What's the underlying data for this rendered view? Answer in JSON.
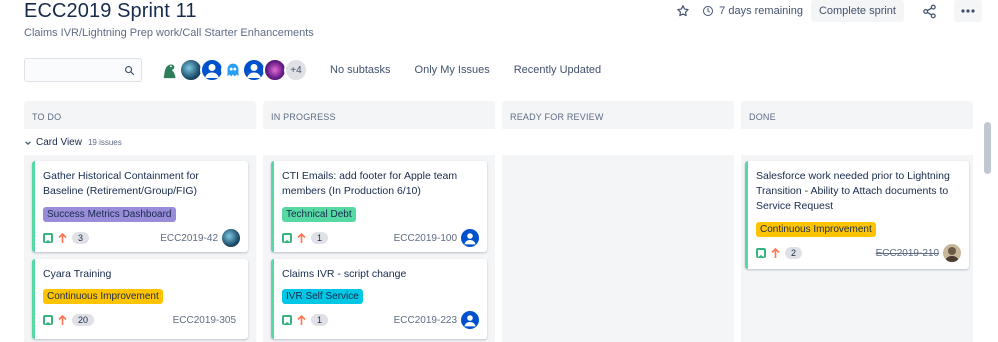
{
  "header": {
    "title": "ECC2019 Sprint 11",
    "subtitle": "Claims IVR/Lightning Prep work/Call Starter Enhancements",
    "remaining": "7 days remaining",
    "complete_label": "Complete sprint",
    "star_icon": "star-icon",
    "clock_icon": "clock-icon",
    "share_icon": "share-icon",
    "more_icon": "more-icon"
  },
  "toolbar": {
    "search_value": "",
    "avatars_more": "+4",
    "filters": [
      "No subtasks",
      "Only My Issues",
      "Recently Updated"
    ]
  },
  "columns": [
    "TO DO",
    "IN PROGRESS",
    "READY FOR REVIEW",
    "DONE"
  ],
  "swimlane": {
    "label": "Card View",
    "count": "19 issues"
  },
  "cards": {
    "todo": [
      {
        "summary": "Gather Historical Containment for Baseline (Retirement/Group/FIG)",
        "epic": "Success Metrics Dashboard",
        "epic_color": "#998dd9",
        "estimate": "3",
        "key": "ECC2019-42"
      },
      {
        "summary": "Cyara Training",
        "epic": "Continuous Improvement",
        "epic_color": "#ffc400",
        "estimate": "20",
        "key": "ECC2019-305"
      }
    ],
    "in_progress": [
      {
        "summary": "CTI Emails: add footer for Apple team members (In Production 6/10)",
        "epic": "Technical Debt",
        "epic_color": "#57d9a3",
        "estimate": "1",
        "key": "ECC2019-100"
      },
      {
        "summary": "Claims IVR - script change",
        "epic": "IVR Self Service",
        "epic_color": "#00c7e6",
        "estimate": "1",
        "key": "ECC2019-223"
      }
    ],
    "done": [
      {
        "summary": "Salesforce work needed prior to Lightning Transition - Ability to Attach documents to Service Request",
        "epic": "Continuous Improvement",
        "epic_color": "#ffc400",
        "estimate": "2",
        "key": "ECC2019-210"
      }
    ]
  },
  "colors": {
    "story": "#36b37e",
    "priority_high": "#ff7452",
    "card_border": "#57d9a3",
    "column_bg": "#f4f5f7"
  }
}
